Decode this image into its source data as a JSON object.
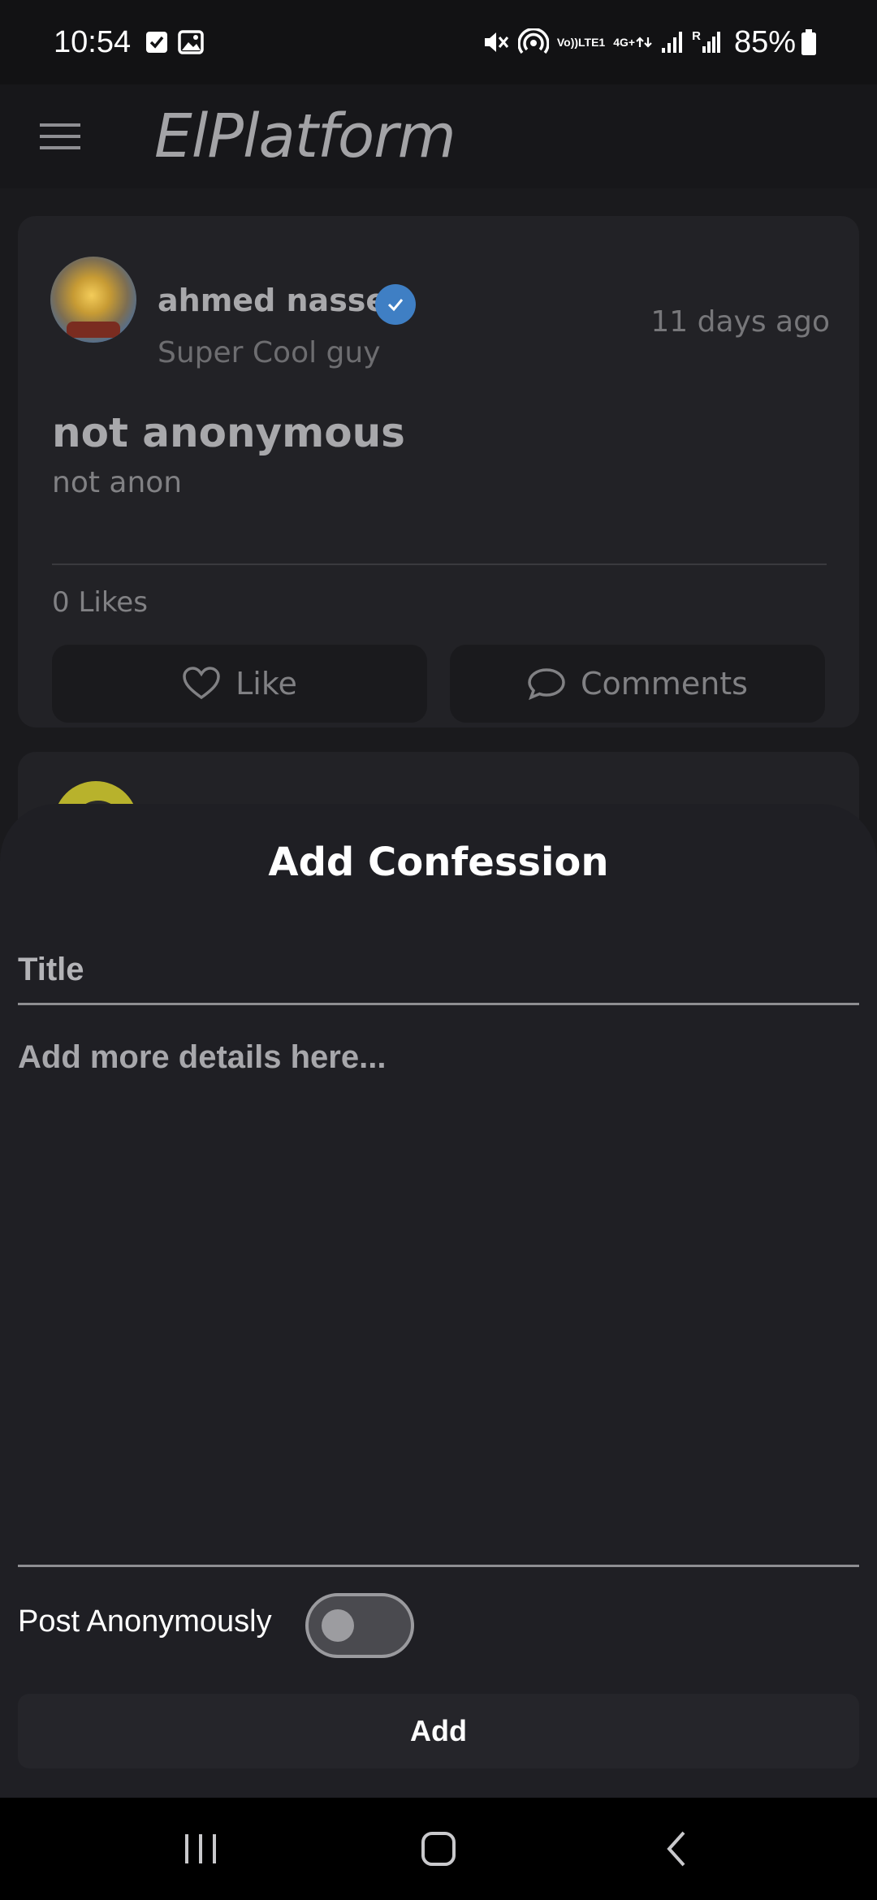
{
  "status_bar": {
    "time": "10:54",
    "volte_top": "Vo))",
    "volte_bottom": "LTE1",
    "network_type": "4G+",
    "roaming": "R",
    "battery": "85%"
  },
  "app_bar": {
    "title": "ElPlatform",
    "menu_icon": "hamburger-menu-icon"
  },
  "feed": {
    "posts": [
      {
        "author": "ahmed nasser",
        "verified": true,
        "subtitle": "Super Cool guy",
        "time": "11 days ago",
        "title": "not anonymous",
        "body": "not anon",
        "likes": "0 Likes",
        "like_label": "Like",
        "comments_label": "Comments"
      }
    ]
  },
  "sheet": {
    "title": "Add Confession",
    "title_placeholder": "Title",
    "title_value": "",
    "details_placeholder": "Add more details here...",
    "details_value": "",
    "anon_label": "Post Anonymously",
    "anon_enabled": false,
    "add_label": "Add"
  },
  "colors": {
    "background": "#1a1a1d",
    "sheet": "#1f1f24",
    "verified": "#3f7fc4"
  }
}
